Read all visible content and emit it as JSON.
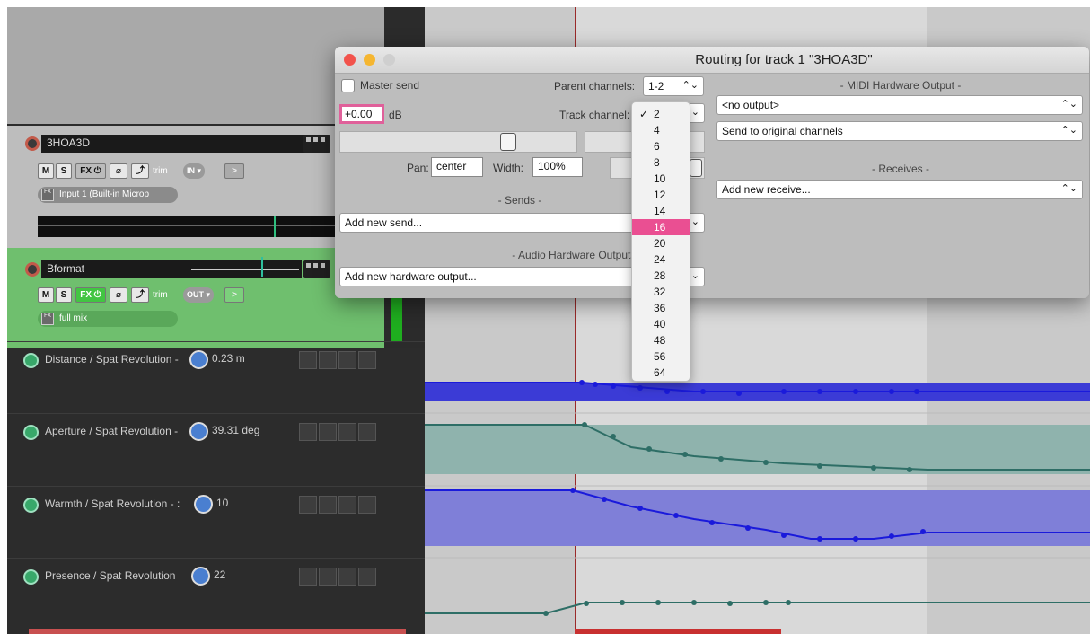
{
  "tracks": [
    {
      "name": "3HOA3D",
      "m": "M",
      "s": "S",
      "fx": "FX",
      "trim": "trim",
      "io": "IN",
      "input": "Input 1 (Built-in Microp",
      "fx_badge": "FX"
    },
    {
      "name": "Bformat",
      "m": "M",
      "s": "S",
      "fx": "FX",
      "trim": "trim",
      "io": "OUT",
      "input": "full mix",
      "fx_badge": "FX"
    }
  ],
  "envelopes": [
    {
      "name": "Distance / Spat Revolution -",
      "value": "0.23 m"
    },
    {
      "name": "Aperture / Spat Revolution -",
      "value": "39.31 deg"
    },
    {
      "name": "Warmth / Spat Revolution - :",
      "value": "10"
    },
    {
      "name": "Presence / Spat Revolution",
      "value": "22"
    }
  ],
  "routing": {
    "title": "Routing for track 1 \"3HOA3D\"",
    "master_send_label": "Master send",
    "parent_channels_label": "Parent channels:",
    "parent_channels_value": "1-2",
    "volume_value": "+0.00",
    "volume_unit": "dB",
    "track_channels_label": "Track channel:",
    "pan_label": "Pan:",
    "pan_value": "center",
    "width_label": "Width:",
    "width_value": "100%",
    "sends_title": "- Sends -",
    "add_send": "Add new send...",
    "hw_outputs_title": "- Audio Hardware Outputs -",
    "add_hw_output": "Add new hardware output...",
    "midi_title": "- MIDI Hardware Output -",
    "midi_output": "<no output>",
    "midi_channels": "Send to original channels",
    "receives_title": "- Receives -",
    "add_receive": "Add new receive..."
  },
  "channel_menu": {
    "checked": "2",
    "selected": "16",
    "items": [
      "2",
      "4",
      "6",
      "8",
      "10",
      "12",
      "14",
      "16",
      "20",
      "24",
      "28",
      "32",
      "36",
      "40",
      "48",
      "56",
      "64"
    ]
  },
  "colors": {
    "selected_highlight": "#ea4f92",
    "envelope_blue": "#1a1adb",
    "envelope_teal": "#2e6e66",
    "track_green": "#6fbf6e"
  }
}
